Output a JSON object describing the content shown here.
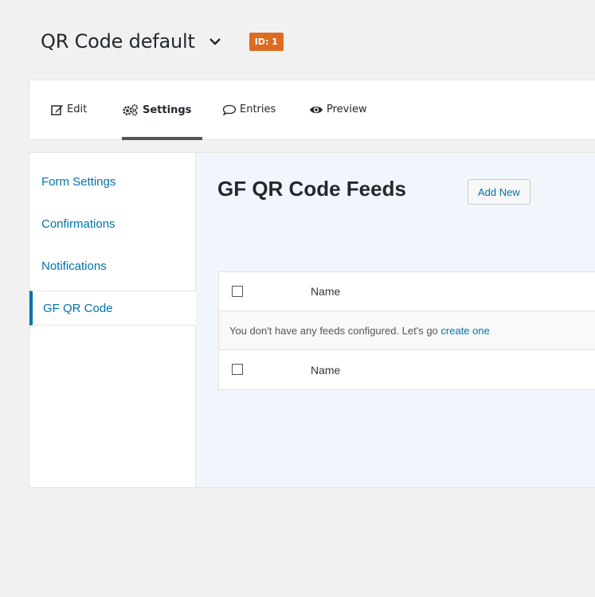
{
  "header": {
    "form_title": "QR Code default",
    "id_badge": "ID: 1"
  },
  "toolbar": {
    "edit": "Edit",
    "settings": "Settings",
    "entries": "Entries",
    "preview": "Preview"
  },
  "sidebar": {
    "items": [
      {
        "label": "Form Settings"
      },
      {
        "label": "Confirmations"
      },
      {
        "label": "Notifications"
      },
      {
        "label": "GF QR Code"
      }
    ]
  },
  "main": {
    "heading": "GF QR Code Feeds",
    "add_new": "Add New",
    "table": {
      "column_name": "Name",
      "empty_message": "You don't have any feeds configured. Let's go ",
      "empty_link": "create one"
    }
  },
  "colors": {
    "accent": "#0073aa",
    "badge": "#dd6b20"
  }
}
